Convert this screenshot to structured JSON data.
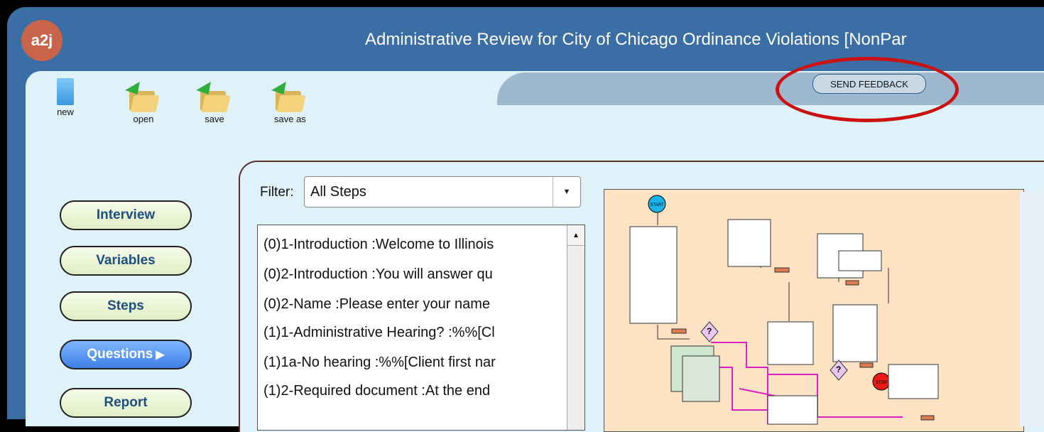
{
  "app": {
    "logo_text": "a2j",
    "title": "Administrative Review for City of Chicago Ordinance Violations [NonPar"
  },
  "toolbar": {
    "new_label": "new",
    "open_label": "open",
    "save_label": "save",
    "save_as_label": "save as"
  },
  "feedback": {
    "label": "SEND FEEDBACK"
  },
  "nav": {
    "interview": "Interview",
    "variables": "Variables",
    "steps": "Steps",
    "questions": "Questions",
    "report": "Report"
  },
  "filter": {
    "label": "Filter:",
    "value": "All Steps"
  },
  "questions": [
    "(0)1-Introduction :Welcome to Illinois",
    "(0)2-Introduction :You will answer qu",
    "(0)2-Name :Please enter your name",
    "(1)1-Administrative Hearing? :%%[Cl",
    "(1)1a-No hearing :%%[Client first nar",
    "(1)2-Required document :At the end"
  ],
  "flowmap": {
    "start_label": "START",
    "stop_label": "STOP"
  },
  "colors": {
    "header_bg": "#3a6ea5",
    "content_bg": "#dff2fa",
    "active_nav": "#3f7fe6",
    "feedback_highlight": "#cc1111",
    "flowmap_bg": "#fde3c4"
  }
}
